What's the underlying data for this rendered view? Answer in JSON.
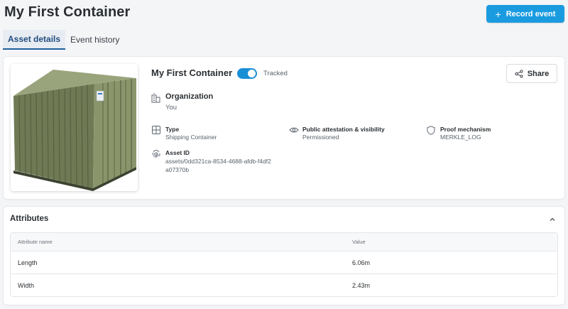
{
  "header": {
    "title": "My First Container",
    "record_event_label": "Record event"
  },
  "tabs": [
    {
      "label": "Asset details",
      "active": true
    },
    {
      "label": "Event history",
      "active": false
    }
  ],
  "asset": {
    "name": "My First Container",
    "tracked_label": "Tracked",
    "tracked": true,
    "share_label": "Share",
    "image_icon": "shipping-container-image",
    "organization": {
      "label": "Organization",
      "value": "You"
    },
    "type": {
      "label": "Type",
      "value": "Shipping Container"
    },
    "visibility": {
      "label": "Public attestation & visibility",
      "value": "Permissioned"
    },
    "proof": {
      "label": "Proof mechanism",
      "value": "MERKLE_LOG"
    },
    "asset_id": {
      "label": "Asset ID",
      "line1": "assets/0dd321ca-8534-4688-afdb-f4df2",
      "line2": "a07370b"
    }
  },
  "attributes": {
    "title": "Attributes",
    "columns": [
      "Attribute name",
      "Value"
    ],
    "rows": [
      {
        "name": "Length",
        "value": "6.06m"
      },
      {
        "name": "Width",
        "value": "2.43m"
      }
    ]
  },
  "colors": {
    "accent": "#1a9be0",
    "tab_active_text": "#234e7e",
    "toggle_on": "#1a8fd6",
    "container_green": "#7b8660"
  }
}
